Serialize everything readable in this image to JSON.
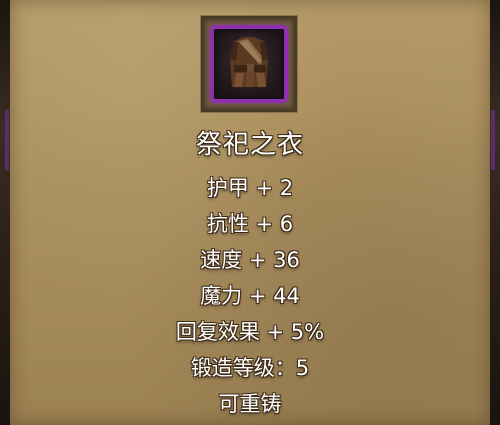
{
  "item": {
    "icon": "robe-armor-icon",
    "rarity_color": "#8e2fb0",
    "name": "祭祀之衣"
  },
  "stats": [
    "护甲 + 2",
    "抗性 + 6",
    "速度 + 36",
    "魔力 + 44",
    "回复效果 + 5%",
    "锻造等级：5",
    "可重铸"
  ]
}
